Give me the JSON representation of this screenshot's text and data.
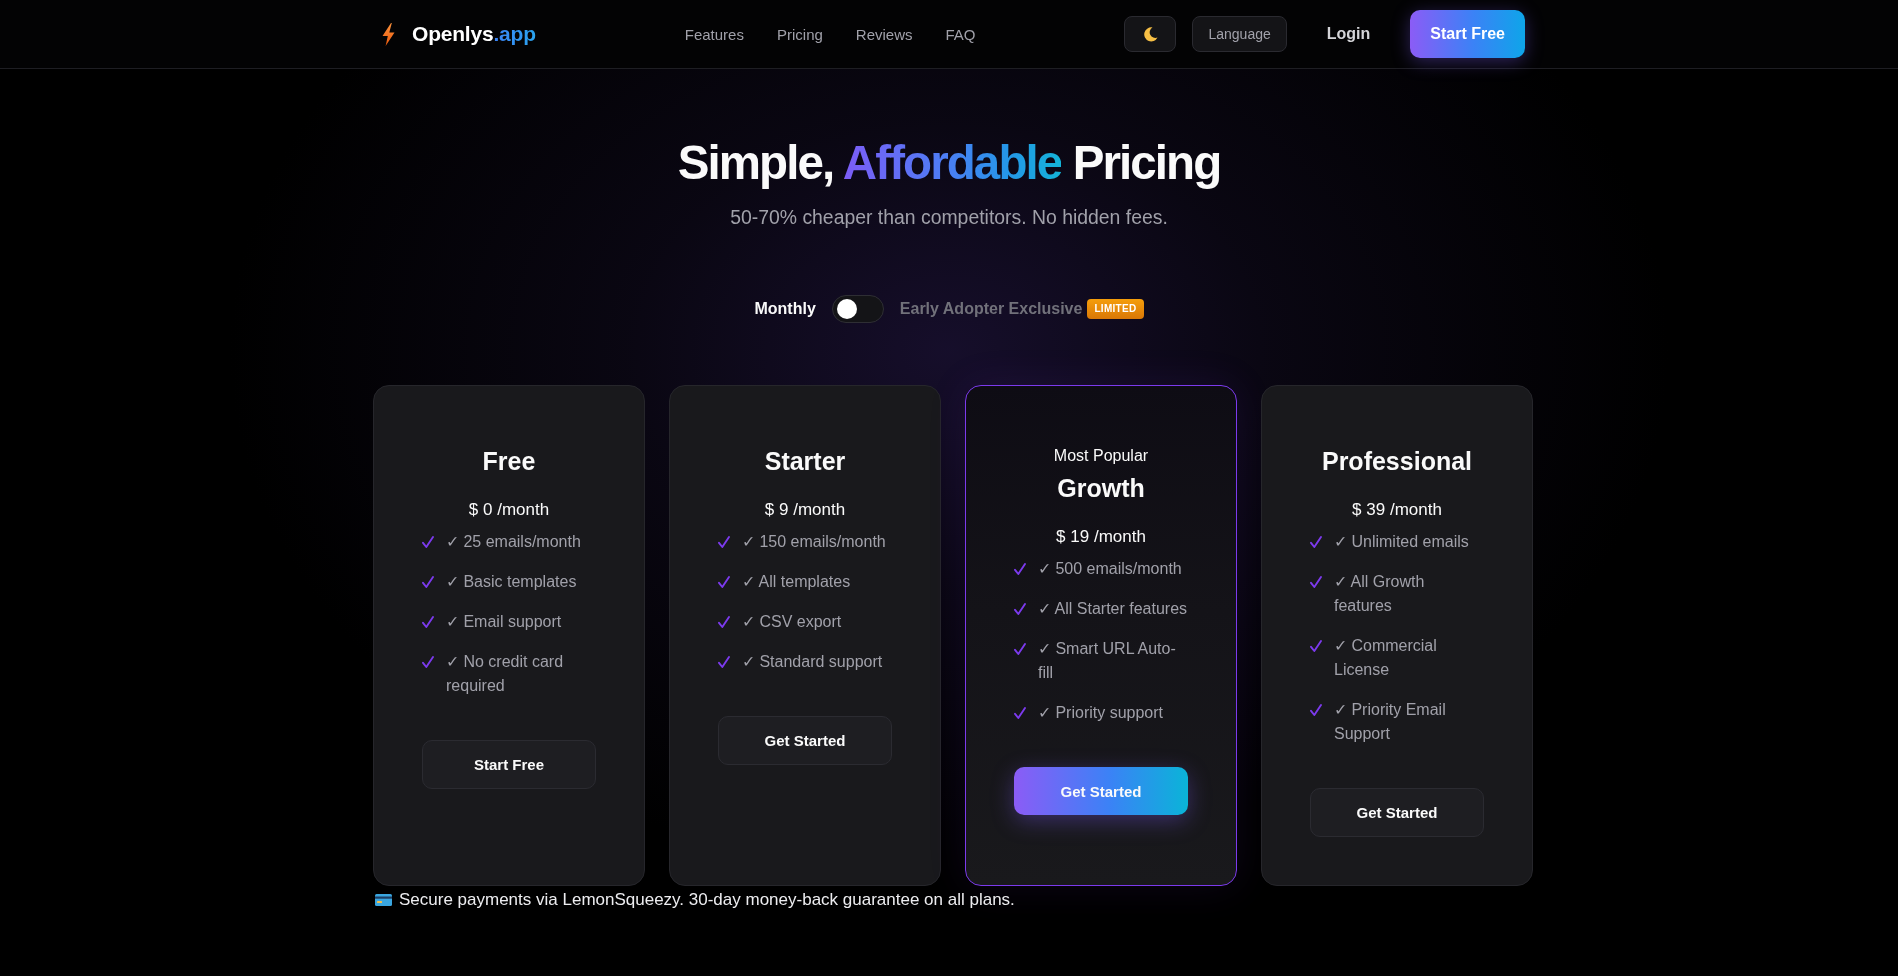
{
  "header": {
    "logo": {
      "name": "Openlys",
      "suffix": ".app"
    },
    "nav": [
      "Features",
      "Pricing",
      "Reviews",
      "FAQ"
    ],
    "language_button": "Language",
    "login": "Login",
    "cta_button": "Start Free"
  },
  "hero": {
    "title": [
      {
        "text": "Simple,",
        "highlight": false
      },
      {
        "text": "Affordable",
        "highlight": true
      },
      {
        "text": "Pricing",
        "highlight": false
      }
    ],
    "subtitle": "50-70% cheaper than competitors. No hidden fees."
  },
  "billing_toggle": {
    "left_label": "Monthly",
    "on": false,
    "right_label": "Early Adopter Exclusive",
    "badge": "LIMITED"
  },
  "plans": [
    {
      "name": "Free",
      "featured": false,
      "price": "$ 0 /month",
      "features": [
        "✓ 25 emails/month",
        "✓ Basic templates",
        "✓ Email support",
        "✓ No credit card required"
      ],
      "button": "Start Free"
    },
    {
      "name": "Starter",
      "featured": false,
      "price": "$ 9 /month",
      "features": [
        "✓ 150 emails/month",
        "✓ All templates",
        "✓ CSV export",
        "✓ Standard support"
      ],
      "button": "Get Started"
    },
    {
      "tag": "Most Popular",
      "name": "Growth",
      "featured": true,
      "price": "$ 19 /month",
      "features": [
        "✓ 500 emails/month",
        "✓ All Starter features",
        "✓ Smart URL Auto-fill",
        "✓ Priority support"
      ],
      "button": "Get Started"
    },
    {
      "name": "Professional",
      "featured": false,
      "price": "$ 39 /month",
      "features": [
        "✓ Unlimited emails",
        "✓ All Growth features",
        "✓ Commercial License",
        "✓ Priority Email Support"
      ],
      "button": "Get Started"
    }
  ],
  "footer_note": "Secure payments via LemonSqueezy. 30-day money-back guarantee on all plans."
}
